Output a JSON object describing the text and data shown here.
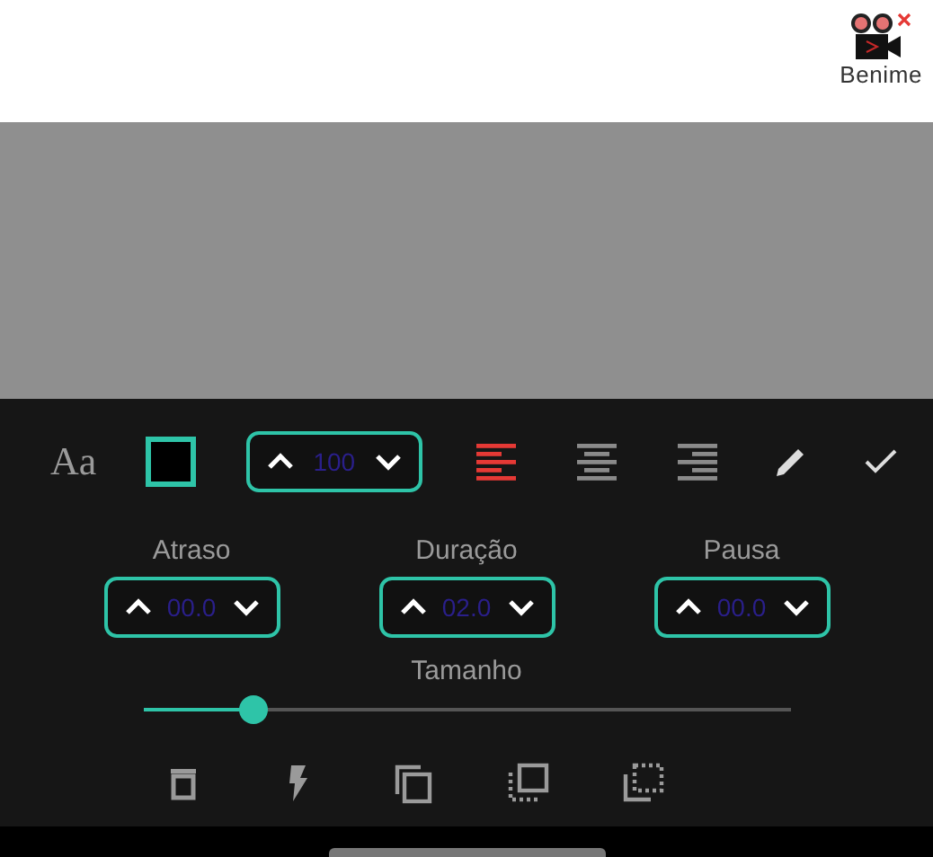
{
  "brand": {
    "name": "Benime"
  },
  "toolbar": {
    "font_button": "Aa",
    "swatch": {
      "color": "#000000"
    },
    "size": {
      "value": "100"
    },
    "alignments": [
      {
        "kind": "left",
        "selected": true
      },
      {
        "kind": "center",
        "selected": false
      },
      {
        "kind": "right",
        "selected": false
      }
    ]
  },
  "timings": [
    {
      "label": "Atraso",
      "value": "00.0"
    },
    {
      "label": "Duração",
      "value": "02.0"
    },
    {
      "label": "Pausa",
      "value": "00.0"
    }
  ],
  "slider": {
    "label": "Tamanho",
    "level": 0.17
  },
  "actions": [
    {
      "kind": "delete"
    },
    {
      "kind": "flash"
    },
    {
      "kind": "copy"
    },
    {
      "kind": "select-front"
    },
    {
      "kind": "select-back"
    }
  ]
}
